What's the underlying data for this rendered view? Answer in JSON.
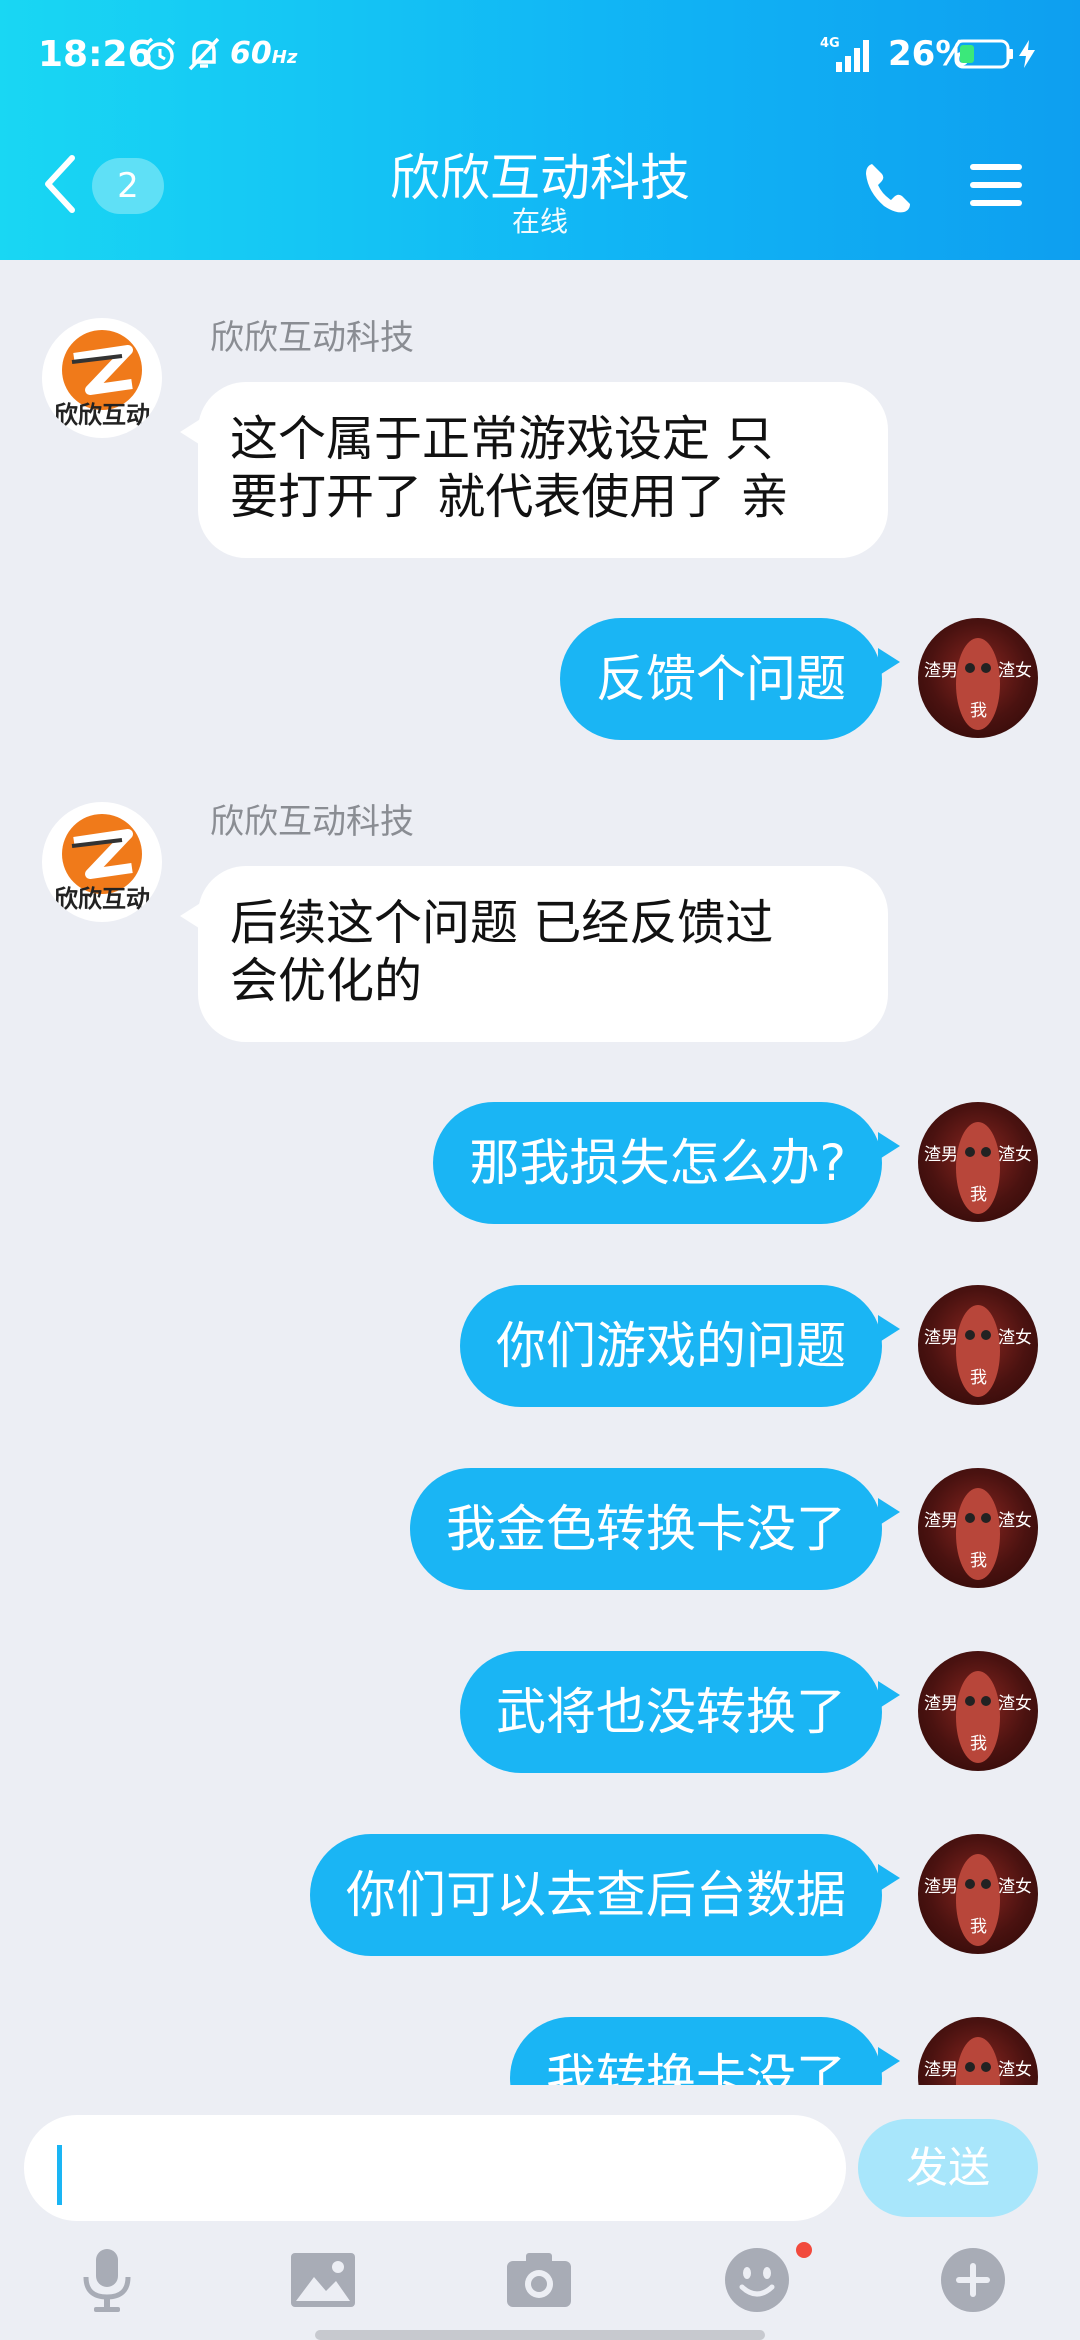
{
  "status_bar": {
    "time": "18:26",
    "refresh_rate": "60",
    "refresh_unit": "Hz",
    "network": "4G",
    "battery": "26%"
  },
  "header": {
    "unread_count": "2",
    "title": "欣欣互动科技",
    "status": "在线"
  },
  "company": {
    "logo_text": "欣欣互动"
  },
  "me": {
    "avatar_left": "渣男",
    "avatar_right": "渣女",
    "avatar_bottom": "我"
  },
  "messages": [
    {
      "from": "company",
      "sender": "欣欣互动科技",
      "lines": [
        "这个属于正常游戏设定 只",
        "要打开了 就代表使用了 亲"
      ]
    },
    {
      "from": "me",
      "text": "反馈个问题"
    },
    {
      "from": "company",
      "sender": "欣欣互动科技",
      "lines": [
        "后续这个问题 已经反馈过",
        "会优化的"
      ]
    },
    {
      "from": "me",
      "text": "那我损失怎么办?"
    },
    {
      "from": "me",
      "text": "你们游戏的问题"
    },
    {
      "from": "me",
      "text": "我金色转换卡没了"
    },
    {
      "from": "me",
      "text": "武将也没转换了"
    },
    {
      "from": "me",
      "text": "你们可以去查后台数据"
    },
    {
      "from": "me",
      "text": "我转换卡没了"
    }
  ],
  "input": {
    "value": "",
    "send_label": "发送"
  },
  "toolbar": [
    "mic-icon",
    "image-icon",
    "camera-icon",
    "emoji-icon",
    "plus-icon"
  ],
  "colors": {
    "header_start": "#19d7f3",
    "header_end": "#0e9ff0",
    "bubble_out": "#1ab5f4",
    "bubble_in": "#ffffff",
    "background": "#eceef4",
    "send_button": "#a8e6fb"
  }
}
